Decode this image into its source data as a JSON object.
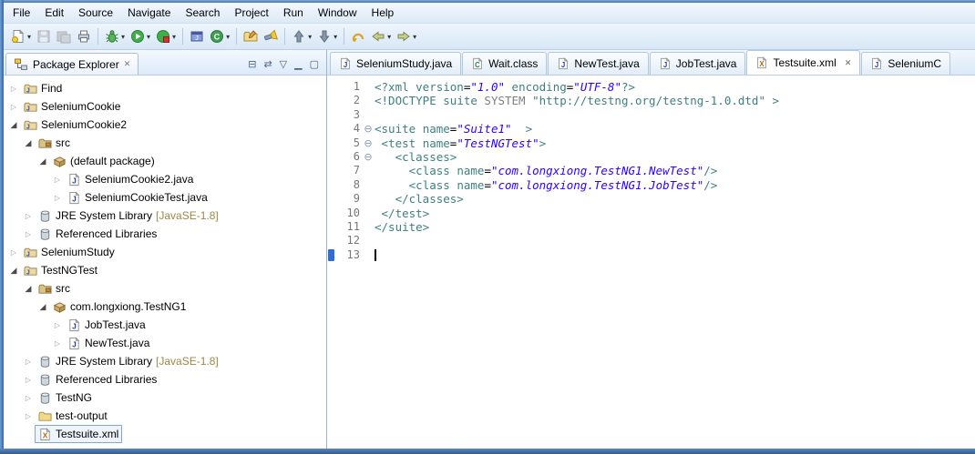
{
  "menubar": {
    "items": [
      "File",
      "Edit",
      "Source",
      "Navigate",
      "Search",
      "Project",
      "Run",
      "Window",
      "Help"
    ]
  },
  "toolbar": {
    "buttons": [
      {
        "name": "new-wizard",
        "icon": "new",
        "caret": true
      },
      {
        "name": "save",
        "icon": "save",
        "disabled": true
      },
      {
        "name": "save-all",
        "icon": "saveall",
        "disabled": true
      },
      {
        "name": "print",
        "icon": "print"
      },
      {
        "sep": true
      },
      {
        "name": "debug",
        "icon": "bug",
        "caret": true
      },
      {
        "name": "run",
        "icon": "run",
        "caret": true
      },
      {
        "name": "coverage",
        "icon": "coverage",
        "caret": true
      },
      {
        "sep": true
      },
      {
        "name": "new-java-project",
        "icon": "project-new"
      },
      {
        "name": "new-class",
        "icon": "class-new",
        "caret": true
      },
      {
        "sep": true
      },
      {
        "name": "open-type",
        "icon": "folder-open"
      },
      {
        "name": "search",
        "icon": "torch"
      },
      {
        "sep": true
      },
      {
        "name": "previous-annotation",
        "icon": "arrow-up",
        "caret": true
      },
      {
        "name": "next-annotation",
        "icon": "arrow-down",
        "caret": true
      },
      {
        "sep": true
      },
      {
        "name": "last-edit-location",
        "icon": "back-curved"
      },
      {
        "name": "back",
        "icon": "arrow-left",
        "caret": true
      },
      {
        "name": "forward",
        "icon": "arrow-right",
        "caret": true
      }
    ]
  },
  "package_explorer": {
    "title": "Package Explorer",
    "tools": [
      {
        "name": "collapse-all"
      },
      {
        "name": "link-with-editor"
      },
      {
        "name": "view-menu"
      },
      {
        "name": "minimize"
      },
      {
        "name": "maximize"
      }
    ],
    "tree": [
      {
        "label": "Find",
        "depth": 0,
        "arrow": "collapsed",
        "icon": "project"
      },
      {
        "label": "SeleniumCookie",
        "depth": 0,
        "arrow": "collapsed",
        "icon": "project"
      },
      {
        "label": "SeleniumCookie2",
        "depth": 0,
        "arrow": "expanded",
        "icon": "project"
      },
      {
        "label": "src",
        "depth": 1,
        "arrow": "expanded",
        "icon": "src"
      },
      {
        "label": "(default package)",
        "depth": 2,
        "arrow": "expanded",
        "icon": "package"
      },
      {
        "label": "SeleniumCookie2.java",
        "depth": 3,
        "arrow": "collapsed",
        "icon": "javafile"
      },
      {
        "label": "SeleniumCookieTest.java",
        "depth": 3,
        "arrow": "collapsed",
        "icon": "javafile"
      },
      {
        "label": "JRE System Library",
        "qualifier": " [JavaSE-1.8]",
        "depth": 1,
        "arrow": "collapsed",
        "icon": "library"
      },
      {
        "label": "Referenced Libraries",
        "depth": 1,
        "arrow": "collapsed",
        "icon": "library"
      },
      {
        "label": "SeleniumStudy",
        "depth": 0,
        "arrow": "collapsed",
        "icon": "project"
      },
      {
        "label": "TestNGTest",
        "depth": 0,
        "arrow": "expanded",
        "icon": "project"
      },
      {
        "label": "src",
        "depth": 1,
        "arrow": "expanded",
        "icon": "src"
      },
      {
        "label": "com.longxiong.TestNG1",
        "depth": 2,
        "arrow": "expanded",
        "icon": "package"
      },
      {
        "label": "JobTest.java",
        "depth": 3,
        "arrow": "collapsed",
        "icon": "javafile"
      },
      {
        "label": "NewTest.java",
        "depth": 3,
        "arrow": "collapsed",
        "icon": "javafile"
      },
      {
        "label": "JRE System Library",
        "qualifier": " [JavaSE-1.8]",
        "depth": 1,
        "arrow": "collapsed",
        "icon": "library"
      },
      {
        "label": "Referenced Libraries",
        "depth": 1,
        "arrow": "collapsed",
        "icon": "library"
      },
      {
        "label": "TestNG",
        "depth": 1,
        "arrow": "collapsed",
        "icon": "library"
      },
      {
        "label": "test-output",
        "depth": 1,
        "arrow": "collapsed",
        "icon": "folder"
      },
      {
        "label": "Testsuite.xml",
        "depth": 1,
        "arrow": "none",
        "icon": "xmlfile",
        "selected": true
      }
    ]
  },
  "editor": {
    "tabs": [
      {
        "label": "SeleniumStudy.java",
        "icon": "javafile"
      },
      {
        "label": "Wait.class",
        "icon": "classfile"
      },
      {
        "label": "NewTest.java",
        "icon": "javafile"
      },
      {
        "label": "JobTest.java",
        "icon": "javafile"
      },
      {
        "label": "Testsuite.xml",
        "icon": "xmlfile",
        "active": true,
        "close": true
      },
      {
        "label": "SeleniumC",
        "icon": "javafile"
      }
    ],
    "code": {
      "lines": [
        {
          "num": "1",
          "segs": [
            [
              "t",
              "<?xml "
            ],
            [
              "a",
              "version"
            ],
            [
              "p",
              "="
            ],
            [
              "v",
              "\"1.0\""
            ],
            [
              "p",
              " "
            ],
            [
              "a",
              "encoding"
            ],
            [
              "p",
              "="
            ],
            [
              "v",
              "\"UTF-8\""
            ],
            [
              "t",
              "?>"
            ]
          ]
        },
        {
          "num": "2",
          "segs": [
            [
              "t",
              "<!DOCTYPE "
            ],
            [
              "t",
              "suite "
            ],
            [
              "d",
              "SYSTEM "
            ],
            [
              "t",
              "\"http://testng.org/testng-1.0.dtd\" >"
            ]
          ]
        },
        {
          "num": "3",
          "segs": []
        },
        {
          "num": "4",
          "fold": true,
          "segs": [
            [
              "t",
              "<suite "
            ],
            [
              "a",
              "name"
            ],
            [
              "p",
              "="
            ],
            [
              "v",
              "\"Suite1\""
            ],
            [
              "t",
              "  >"
            ]
          ]
        },
        {
          "num": "5",
          "fold": true,
          "segs": [
            [
              "p",
              " "
            ],
            [
              "t",
              "<test "
            ],
            [
              "a",
              "name"
            ],
            [
              "p",
              "="
            ],
            [
              "v",
              "\"TestNGTest\""
            ],
            [
              "t",
              ">"
            ]
          ]
        },
        {
          "num": "6",
          "fold": true,
          "segs": [
            [
              "p",
              "   "
            ],
            [
              "t",
              "<classes>"
            ]
          ]
        },
        {
          "num": "7",
          "segs": [
            [
              "p",
              "     "
            ],
            [
              "t",
              "<class "
            ],
            [
              "a",
              "name"
            ],
            [
              "p",
              "="
            ],
            [
              "v",
              "\"com.longxiong.TestNG1.NewTest\""
            ],
            [
              "t",
              "/>"
            ]
          ]
        },
        {
          "num": "8",
          "segs": [
            [
              "p",
              "     "
            ],
            [
              "t",
              "<class "
            ],
            [
              "a",
              "name"
            ],
            [
              "p",
              "="
            ],
            [
              "v",
              "\"com.longxiong.TestNG1.JobTest\""
            ],
            [
              "t",
              "/>"
            ]
          ]
        },
        {
          "num": "9",
          "segs": [
            [
              "p",
              "   "
            ],
            [
              "t",
              "</classes>"
            ]
          ]
        },
        {
          "num": "10",
          "segs": [
            [
              "p",
              " "
            ],
            [
              "t",
              "</test>"
            ]
          ]
        },
        {
          "num": "11",
          "segs": [
            [
              "t",
              "</suite>"
            ]
          ]
        },
        {
          "num": "12",
          "segs": []
        },
        {
          "num": "13",
          "segs": [],
          "cursor": true,
          "marker": true
        }
      ]
    }
  },
  "colors": {
    "frame_blue": "#38649e",
    "xml_tag": "#3f7f7f",
    "xml_value": "#2a00ff",
    "line_number": "#787878",
    "library_qualifier": "#9b8948",
    "current_line_marker": "#2f6dd0"
  }
}
